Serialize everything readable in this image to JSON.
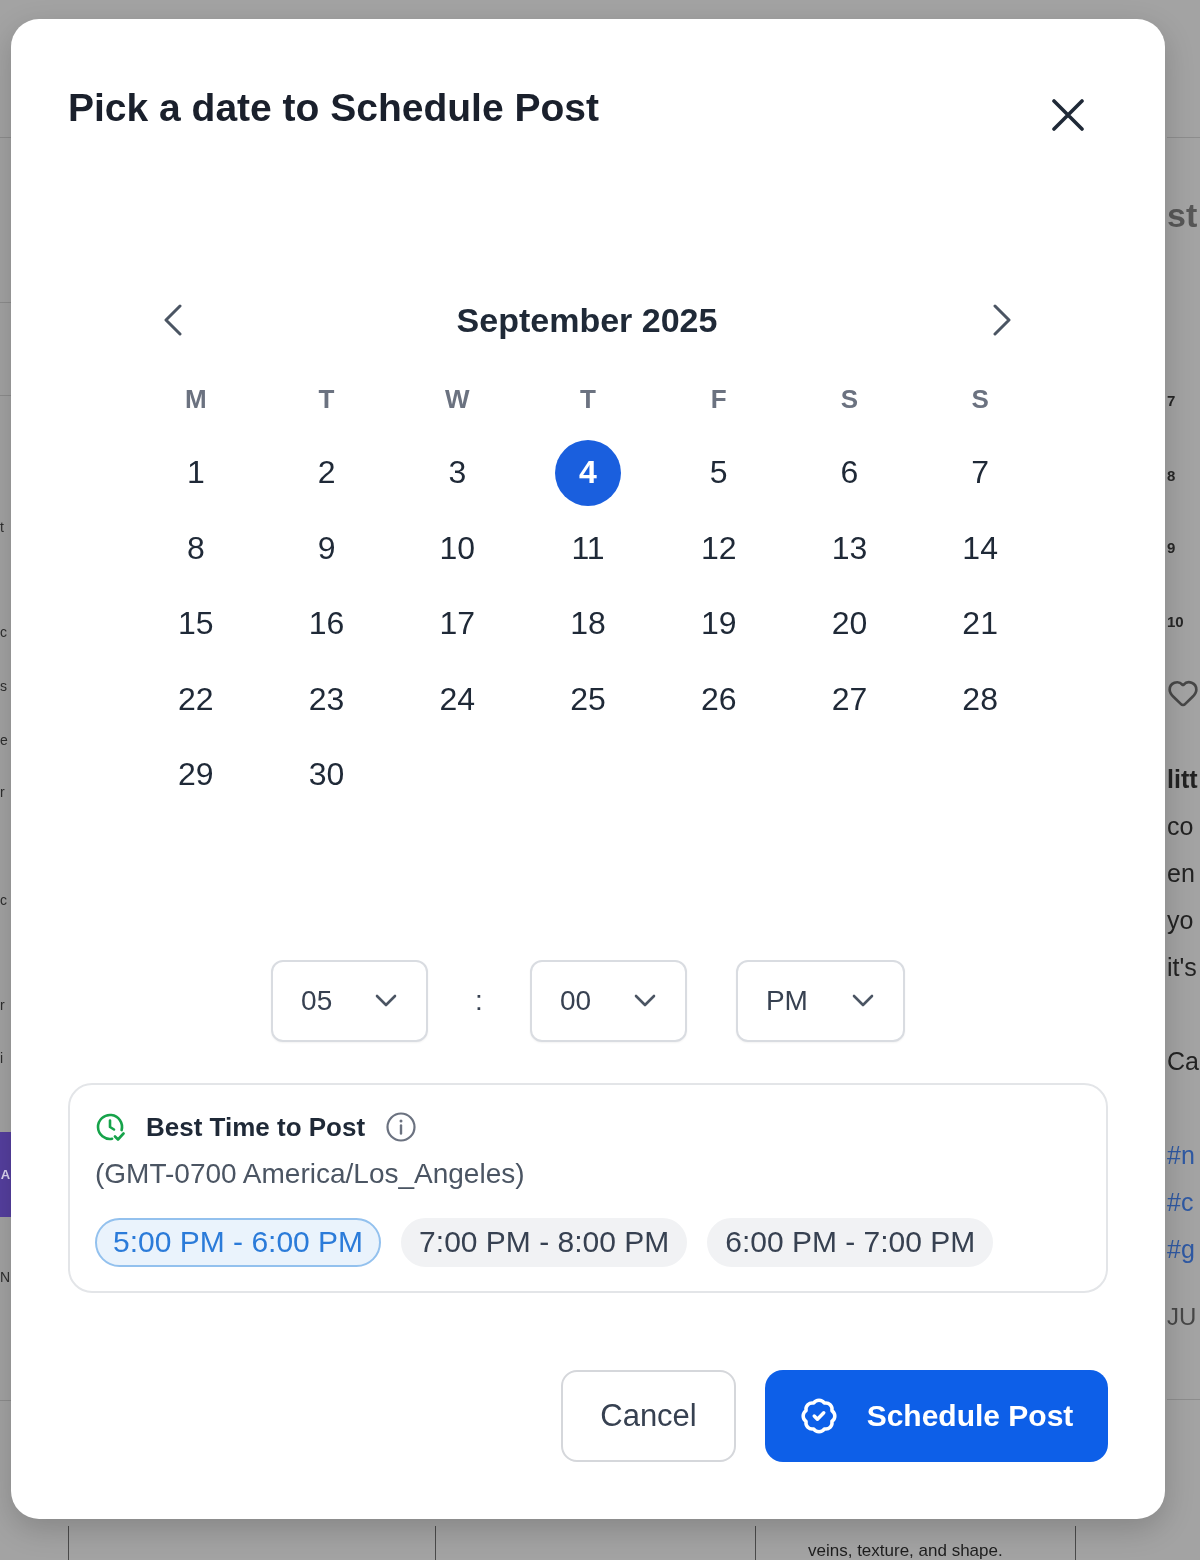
{
  "background_page": {
    "left_edge": {
      "letters": [
        "t",
        "c",
        "s",
        "e",
        "r",
        "c",
        "r",
        "i"
      ],
      "tag": "A",
      "label": "N"
    },
    "right_edge": {
      "heading": "st",
      "numbers": [
        "7",
        "8",
        "9",
        "10"
      ],
      "post_title": "litt",
      "post_lines": [
        "co",
        "en",
        "yo",
        "it's"
      ],
      "post_signoff": "Ca",
      "hashtags": [
        "#n",
        "#c",
        "#g"
      ],
      "date": "JU"
    },
    "table_text": "veins, texture, and shape."
  },
  "dialog": {
    "title": "Pick a date to Schedule Post",
    "calendar": {
      "month": "September 2025",
      "weekdays": [
        "M",
        "T",
        "W",
        "T",
        "F",
        "S",
        "S"
      ],
      "days": [
        {
          "label": "1",
          "selected": false
        },
        {
          "label": "2",
          "selected": false
        },
        {
          "label": "3",
          "selected": false
        },
        {
          "label": "4",
          "selected": true
        },
        {
          "label": "5",
          "selected": false
        },
        {
          "label": "6",
          "selected": false
        },
        {
          "label": "7",
          "selected": false
        },
        {
          "label": "8",
          "selected": false
        },
        {
          "label": "9",
          "selected": false
        },
        {
          "label": "10",
          "selected": false
        },
        {
          "label": "11",
          "selected": false
        },
        {
          "label": "12",
          "selected": false
        },
        {
          "label": "13",
          "selected": false
        },
        {
          "label": "14",
          "selected": false
        },
        {
          "label": "15",
          "selected": false
        },
        {
          "label": "16",
          "selected": false
        },
        {
          "label": "17",
          "selected": false
        },
        {
          "label": "18",
          "selected": false
        },
        {
          "label": "19",
          "selected": false
        },
        {
          "label": "20",
          "selected": false
        },
        {
          "label": "21",
          "selected": false
        },
        {
          "label": "22",
          "selected": false
        },
        {
          "label": "23",
          "selected": false
        },
        {
          "label": "24",
          "selected": false
        },
        {
          "label": "25",
          "selected": false
        },
        {
          "label": "26",
          "selected": false
        },
        {
          "label": "27",
          "selected": false
        },
        {
          "label": "28",
          "selected": false
        },
        {
          "label": "29",
          "selected": false
        },
        {
          "label": "30",
          "selected": false
        }
      ]
    },
    "time": {
      "hour": "05",
      "separator": ":",
      "minute": "00",
      "period": "PM"
    },
    "best_time": {
      "title": "Best Time to Post",
      "timezone": "(GMT-0700 America/Los_Angeles)",
      "slots": [
        {
          "label": "5:00 PM - 6:00 PM",
          "selected": true
        },
        {
          "label": "7:00 PM - 8:00 PM",
          "selected": false
        },
        {
          "label": "6:00 PM - 7:00 PM",
          "selected": false
        }
      ]
    },
    "buttons": [
      {
        "label": "Cancel",
        "kind": "secondary"
      },
      {
        "label": "Schedule Post",
        "kind": "primary"
      }
    ]
  }
}
